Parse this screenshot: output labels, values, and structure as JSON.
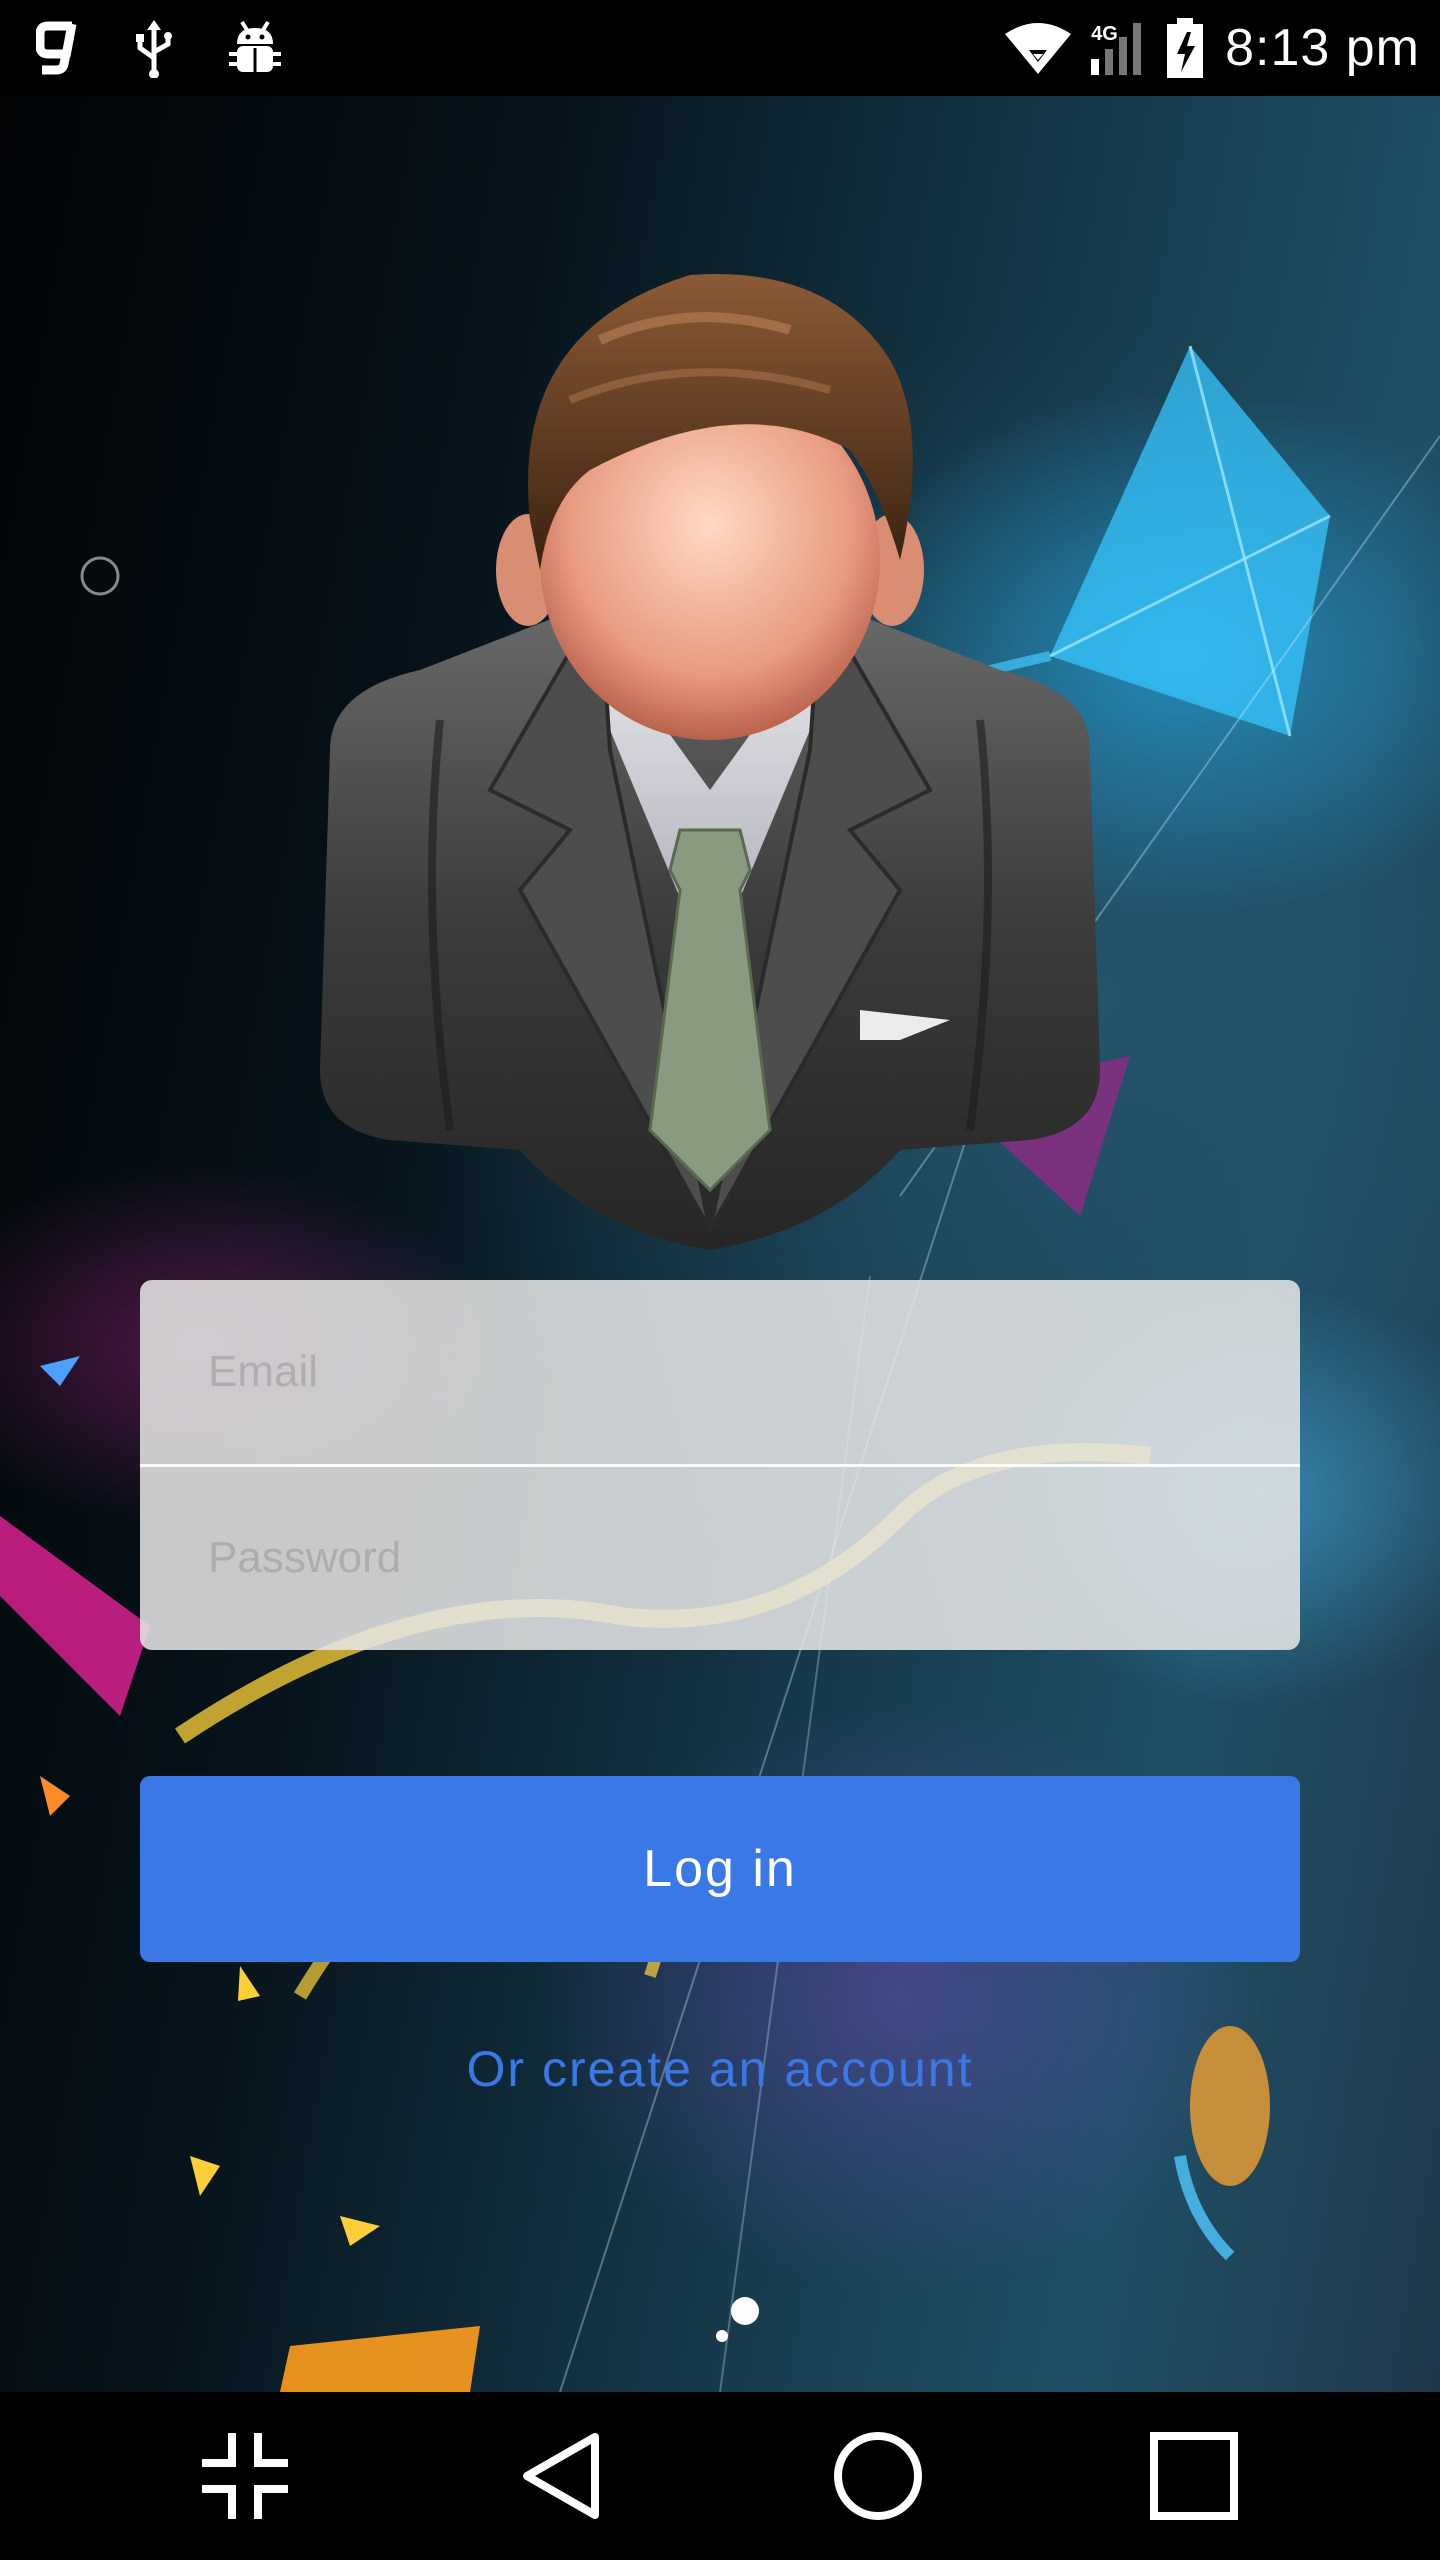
{
  "status_bar": {
    "time": "8:13 pm",
    "network": "4G",
    "left_icons": [
      "g-app-icon",
      "usb-icon",
      "android-debug-icon"
    ],
    "right_icons": [
      "wifi-icon",
      "signal-icon",
      "battery-charging-icon"
    ]
  },
  "login": {
    "email_placeholder": "Email",
    "password_placeholder": "Password",
    "login_label": "Log in",
    "create_account_label": "Or create an account"
  },
  "nav_bar": {
    "buttons": [
      "collapse-icon",
      "back-icon",
      "home-icon",
      "recents-icon"
    ]
  },
  "colors": {
    "accent": "#3a78e6",
    "form_background": "#e8e8e8"
  }
}
